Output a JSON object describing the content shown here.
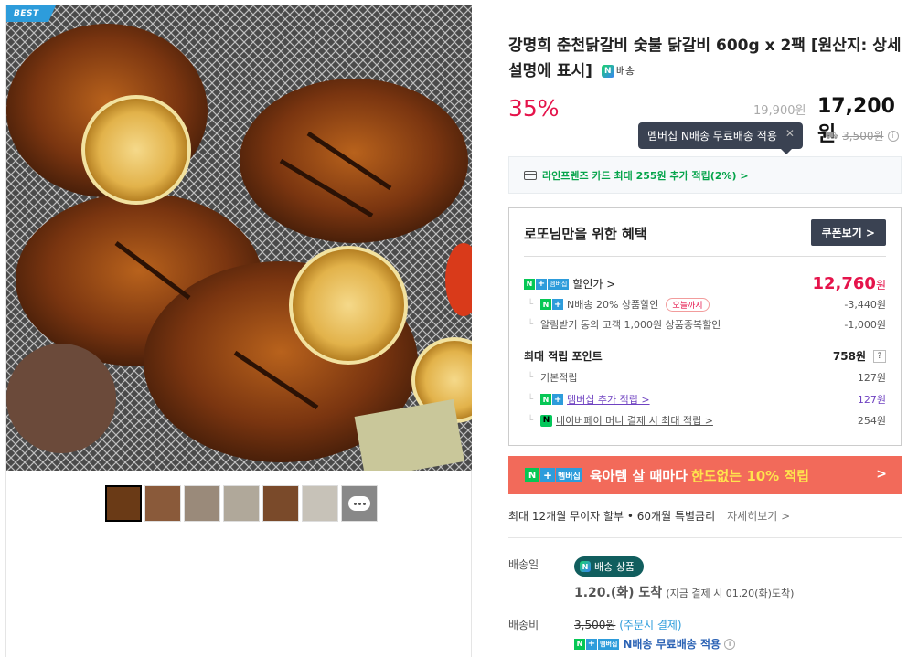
{
  "gallery": {
    "badge": "BEST",
    "thumb_count": 7
  },
  "product": {
    "title": "강명희 춘천닭갈비 숯불 닭갈비 600g x 2팩 [원산지: 상세설명에 표시]",
    "n_delivery_label": "배송",
    "discount": "35%",
    "original_price": "19,900원",
    "sale_price": "17,200원"
  },
  "tooltip": {
    "text": "멤버십 N배송 무료배송 적용"
  },
  "shipping_strike": "3,500원",
  "card_promo": {
    "text": "라인프렌즈 카드 최대 255원 추가 적립(2%) >"
  },
  "benefit": {
    "title": "로또님만을 위한 혜택",
    "coupon_button": "쿠폰보기 >",
    "discount_label": "할인가 >",
    "discount_price": "12,760",
    "won": "원",
    "items": [
      {
        "label": "N배송 20% 상품할인",
        "badge": "오늘까지",
        "value": "-3,440원"
      },
      {
        "label": "알림받기 동의 고객 1,000원 상품중복할인",
        "value": "-1,000원"
      }
    ],
    "points_label": "최대 적립 포인트",
    "points_value": "758원",
    "point_items": [
      {
        "label": "기본적립",
        "value": "127원"
      },
      {
        "label": "멤버십 추가 적립 >",
        "value": "127원"
      },
      {
        "label": "네이버페이 머니 결제 시 최대 적립 >",
        "value": "254원"
      }
    ]
  },
  "banner": {
    "text_white": "육아템 살 때마다",
    "text_yellow": "한도없는 10% 적립",
    "arrow": ">"
  },
  "installment": {
    "text": "최대 12개월 무이자 할부 • 60개월 특별금리",
    "more": "자세히보기 >"
  },
  "delivery": {
    "label_date": "배송일",
    "badge": "배송 상품",
    "arrive_date": "1.20.(화) 도착",
    "arrive_note": "(지금 결제 시 01.20(화)도착)",
    "label_fee": "배송비",
    "fee_strike": "3,500원",
    "fee_note": "(주문시 결제)",
    "fee_applied": "N배송 무료배송 적용"
  },
  "colors": {
    "accent_red": "#e5144b",
    "naver_green": "#06c755",
    "membership_blue": "#2d9cdb",
    "banner_coral": "#f26a5a",
    "dark_button": "#3a4252"
  }
}
